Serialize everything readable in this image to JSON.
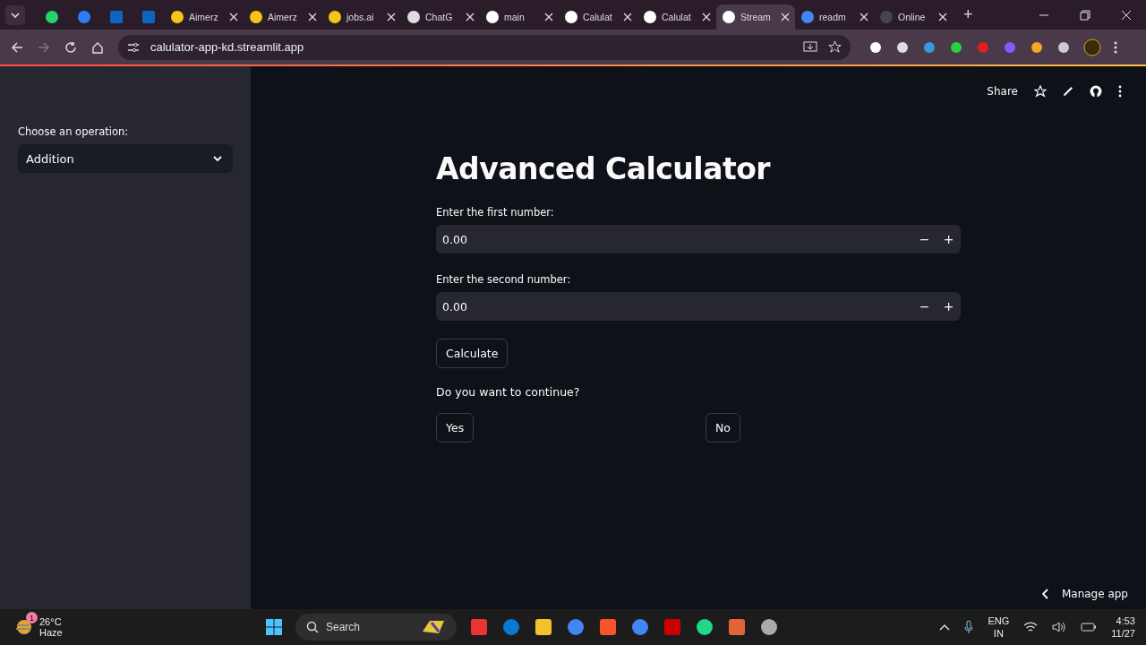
{
  "browser": {
    "tabs": [
      {
        "kind": "pinned",
        "selected": false
      },
      {
        "kind": "pinned",
        "selected": false
      },
      {
        "kind": "pinned",
        "selected": false
      },
      {
        "kind": "pinned",
        "selected": false
      },
      {
        "kind": "normal",
        "label": "Aimerz",
        "selected": false
      },
      {
        "kind": "normal",
        "label": "Aimerz",
        "selected": false
      },
      {
        "kind": "normal",
        "label": "jobs.ai",
        "selected": false
      },
      {
        "kind": "normal",
        "label": "ChatG",
        "selected": false
      },
      {
        "kind": "normal",
        "label": "main",
        "selected": false
      },
      {
        "kind": "normal",
        "label": "Calulat",
        "selected": false
      },
      {
        "kind": "normal",
        "label": "Calulat",
        "selected": false
      },
      {
        "kind": "normal",
        "label": "Stream",
        "selected": true
      },
      {
        "kind": "normal",
        "label": "readm",
        "selected": false
      },
      {
        "kind": "normal",
        "label": "Online",
        "selected": false
      }
    ],
    "new_tab": "+",
    "address": "calulator-app-kd.streamlit.app"
  },
  "sidebar": {
    "label": "Choose an operation:",
    "operation": "Addition"
  },
  "header": {
    "share": "Share"
  },
  "main": {
    "title": "Advanced Calculator",
    "inputs": [
      {
        "label": "Enter the first number:",
        "value": "0.00",
        "minus": "−",
        "plus": "+"
      },
      {
        "label": "Enter the second number:",
        "value": "0.00",
        "minus": "−",
        "plus": "+"
      }
    ],
    "calculate": "Calculate",
    "question": "Do you want to continue?",
    "choices": [
      "Yes",
      "No"
    ]
  },
  "manage_app": "Manage app",
  "taskbar": {
    "weather_badge": "1",
    "temperature": "26°C",
    "condition": "Haze",
    "search_placeholder": "Search",
    "language": "ENG",
    "region": "IN",
    "time": "4:53",
    "date": "11/27"
  }
}
